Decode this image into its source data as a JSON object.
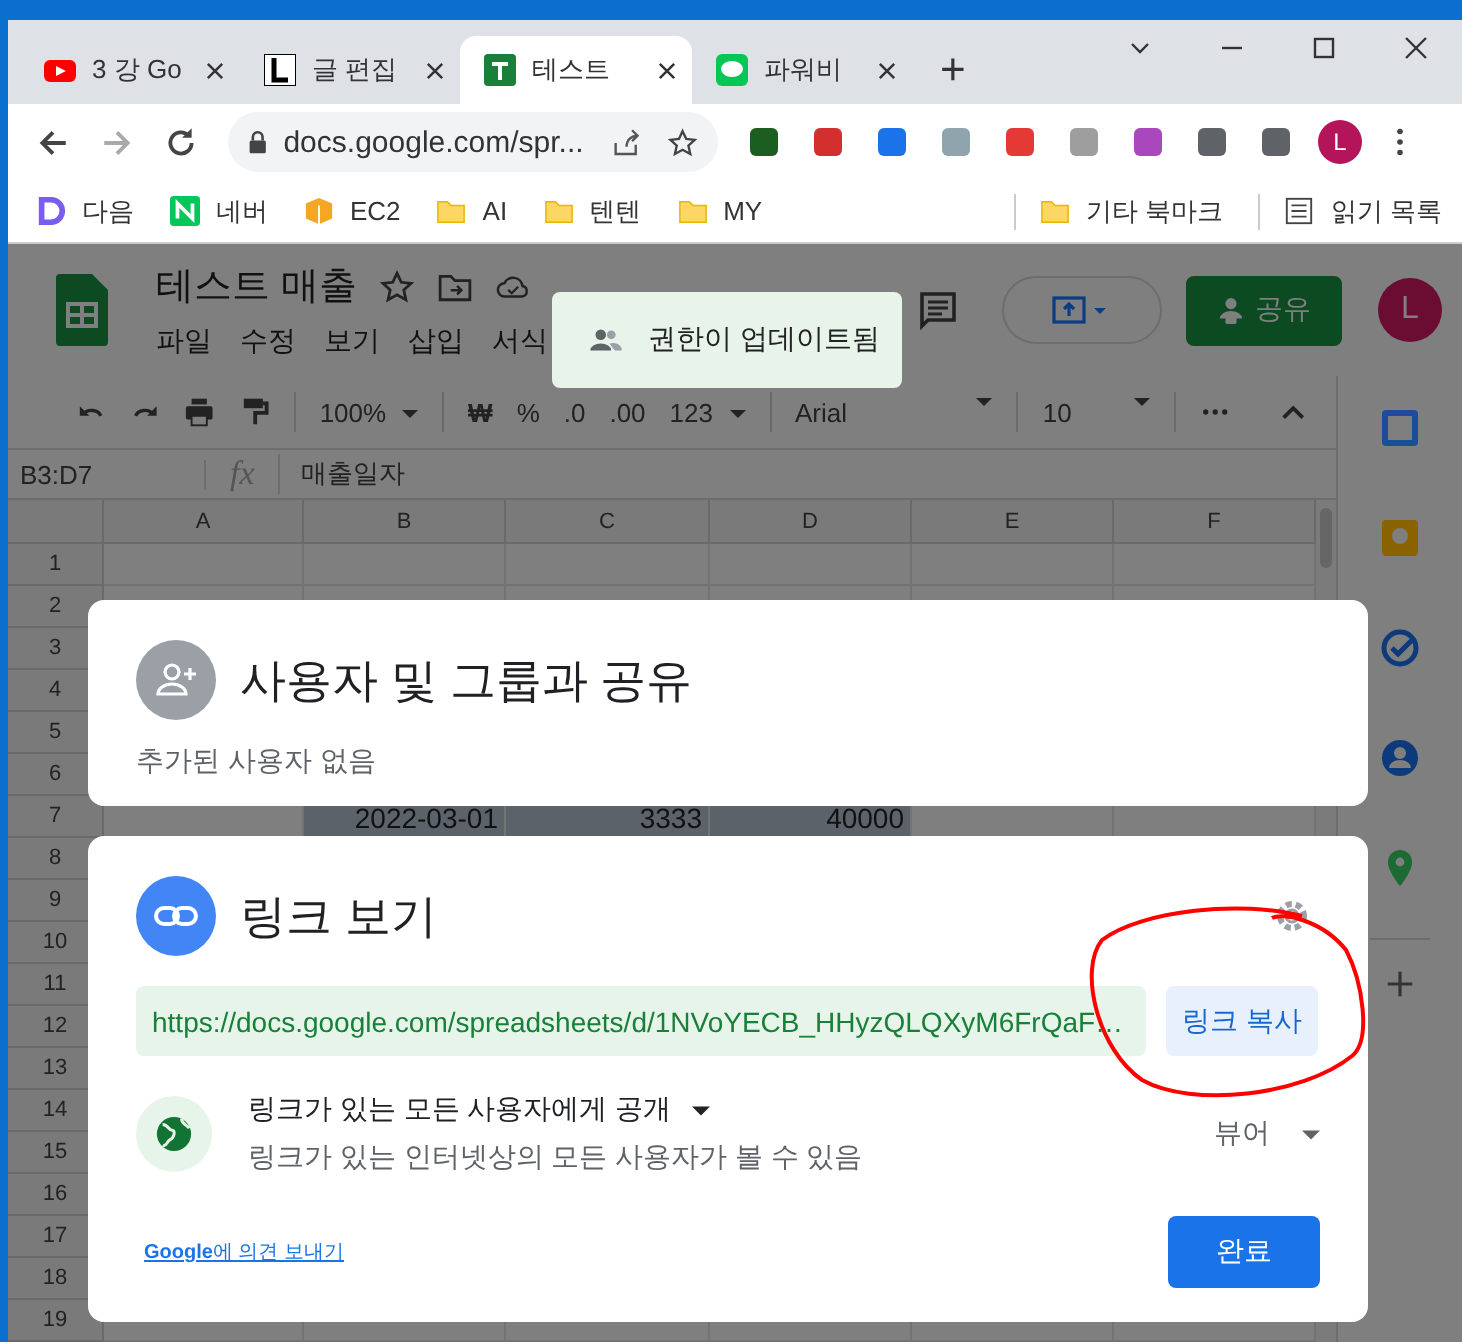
{
  "browser": {
    "tabs": [
      {
        "title": "3 강 Go",
        "kind": "youtube",
        "selected": false
      },
      {
        "title": "글 편집",
        "kind": "letter",
        "selected": false
      },
      {
        "title": "테스트",
        "kind": "sheets",
        "selected": true
      },
      {
        "title": "파워비",
        "kind": "chat",
        "selected": false
      }
    ],
    "new_tab": "+",
    "address": "docs.google.com/spr...",
    "profile_initial": "L",
    "bookmarks": [
      {
        "label": "다음",
        "kind": "daum"
      },
      {
        "label": "네버",
        "kind": "naver"
      },
      {
        "label": "EC2",
        "kind": "box"
      },
      {
        "label": "AI",
        "kind": "folder"
      },
      {
        "label": "텐텐",
        "kind": "folder"
      },
      {
        "label": "MY",
        "kind": "folder"
      }
    ],
    "bookmarks_right": [
      {
        "label": "기타 북마크",
        "kind": "folder"
      },
      {
        "label": "읽기 목록",
        "kind": "list"
      }
    ]
  },
  "sheet": {
    "title": "테스트 매출",
    "menu": [
      "파일",
      "수정",
      "보기",
      "삽입",
      "서식"
    ],
    "share_button": "공유",
    "account_initial": "L",
    "toolbar": {
      "zoom": "100%",
      "currency": "₩",
      "percent": "%",
      "decrease_decimal": ".0",
      "increase_decimal": ".00",
      "number_format": "123",
      "font": "Arial",
      "font_size": "10"
    },
    "name_box": "B3:D7",
    "formula_label": "fx",
    "formula": "매출일자",
    "columns": [
      "A",
      "B",
      "C",
      "D",
      "E",
      "F"
    ],
    "rows": [
      {
        "number": "1",
        "highlighted": false
      },
      {
        "number": "2",
        "highlighted": false
      },
      {
        "number": "3",
        "highlighted": false
      },
      {
        "number": "4",
        "highlighted": false
      },
      {
        "number": "5",
        "highlighted": false
      },
      {
        "number": "6",
        "highlighted": false
      },
      {
        "number": "7",
        "highlighted": true,
        "cells": [
          null,
          "2022-03-01",
          "3333",
          "40000",
          null,
          null
        ]
      },
      {
        "number": "8",
        "highlighted": false
      },
      {
        "number": "9",
        "highlighted": false
      },
      {
        "number": "10",
        "highlighted": false
      },
      {
        "number": "11",
        "highlighted": false
      },
      {
        "number": "12",
        "highlighted": false
      },
      {
        "number": "13",
        "highlighted": false
      },
      {
        "number": "14",
        "highlighted": false
      },
      {
        "number": "15",
        "highlighted": false
      },
      {
        "number": "16",
        "highlighted": false
      },
      {
        "number": "17",
        "highlighted": false
      },
      {
        "number": "18",
        "highlighted": false
      },
      {
        "number": "19",
        "highlighted": false
      }
    ]
  },
  "toast": "권한이 업데이트됨",
  "share_people": {
    "title": "사용자 및 그룹과 공유",
    "subtitle": "추가된 사용자 없음"
  },
  "share_link": {
    "title": "링크 보기",
    "url": "https://docs.google.com/spreadsheets/d/1NVoYECB_HHyzQLQXyM6FrQaF…",
    "copy_button": "링크 복사",
    "access": "링크가 있는 모든 사용자에게 공개",
    "access_description": "링크가 있는 인터넷상의 모든 사용자가 볼 수 있음",
    "role": "뷰어",
    "feedback_link": "**Google**에 의견 보내기",
    "done_button": "완료"
  }
}
